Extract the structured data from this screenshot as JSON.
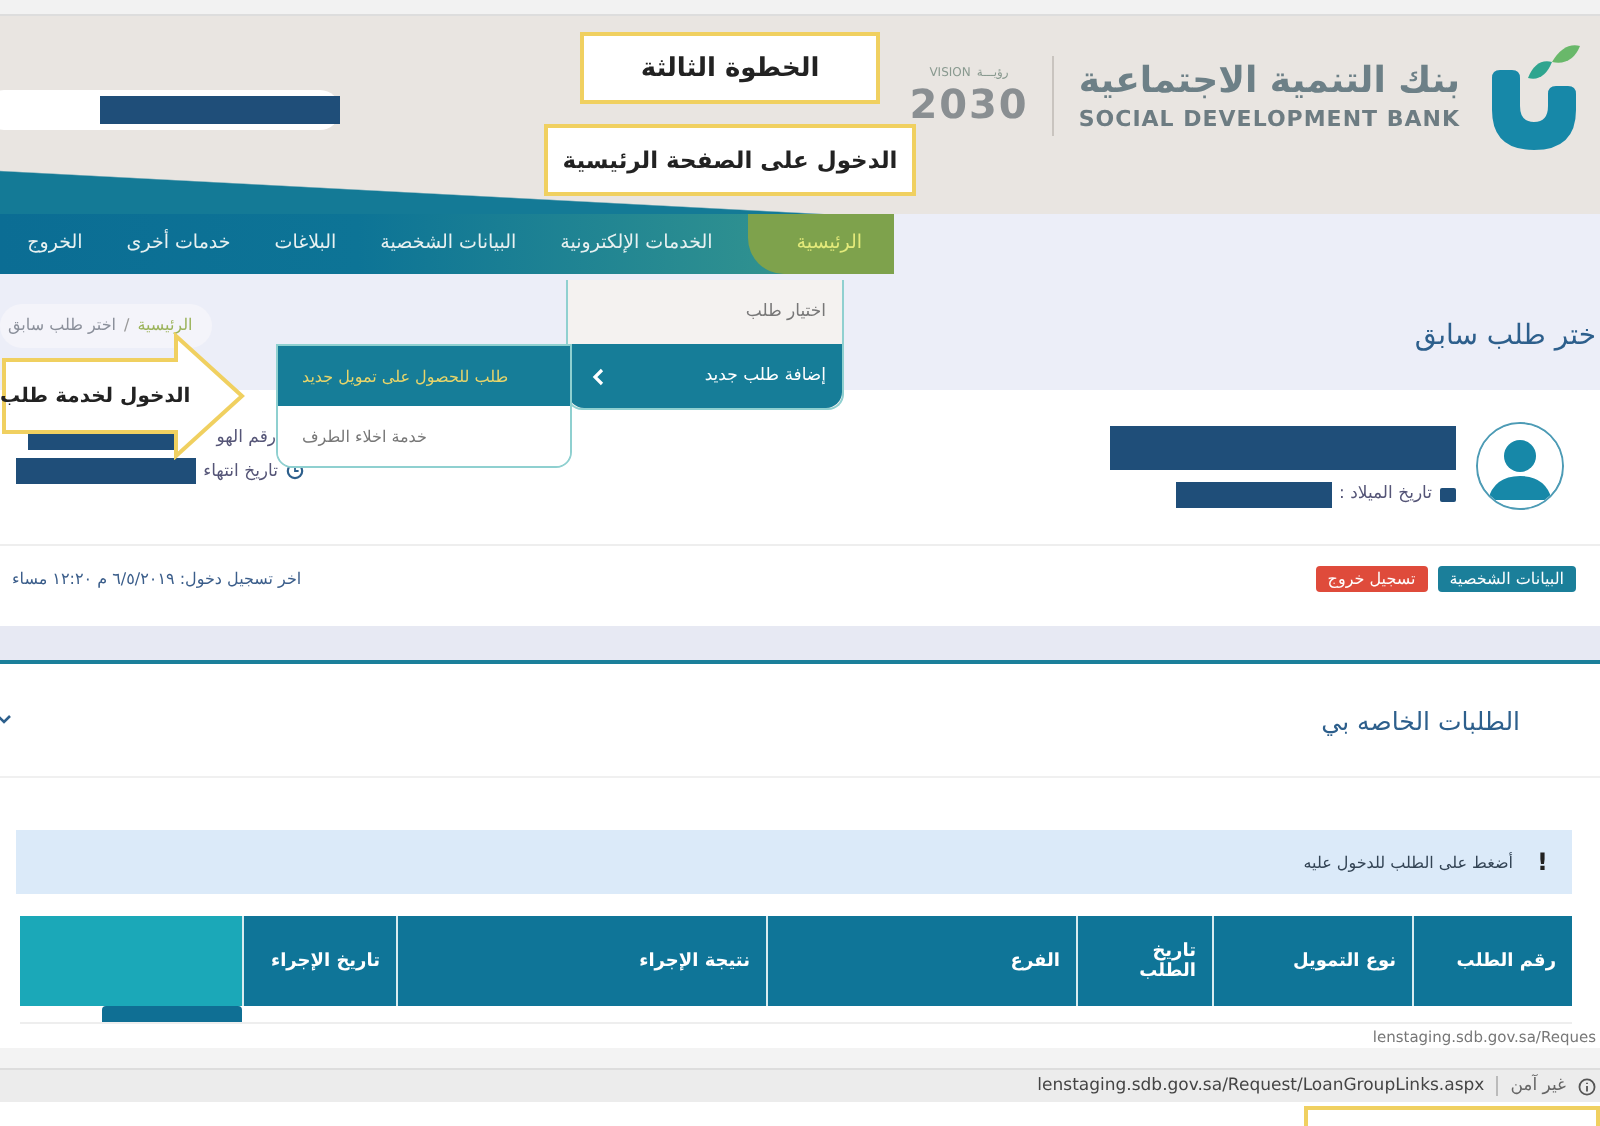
{
  "callouts": [
    {
      "kind": "box",
      "text": "الخطوة الثالثة"
    },
    {
      "kind": "box",
      "text": "الدخول على الصفحة الرئيسية"
    },
    {
      "kind": "arrow",
      "text": "الدخول لخدمة طلب"
    }
  ],
  "header": {
    "logo_arabic": "بنك التنمية الاجتماعية",
    "logo_english": "SOCIAL DEVELOPMENT BANK",
    "vision_label": "VISION",
    "vision_arabic": "رؤيـــة",
    "vision_year": "2030"
  },
  "nav": [
    {
      "label": "الرئيسية",
      "selected": true
    },
    {
      "label": "الخدمات الإلكترونية",
      "selected": false
    },
    {
      "label": "البيانات الشخصية",
      "selected": false
    },
    {
      "label": "البلاغات",
      "selected": false
    },
    {
      "label": "خدمات أخرى",
      "selected": false
    },
    {
      "label": "الخروج",
      "selected": false
    }
  ],
  "menu": [
    {
      "label": "اختيار طلب",
      "selected": false
    },
    {
      "label": "إضافة طلب جديد",
      "selected": true,
      "expanded": true,
      "children": [
        {
          "label": "طلب للحصول على تمويل جديد",
          "selected": true
        },
        {
          "label": "خدمة اخلاء الطرف",
          "selected": false
        }
      ]
    }
  ],
  "page_title": "ختر طلب سابق",
  "breadcrumb": {
    "home": "الرئيسية",
    "separator": "/",
    "current": "اختر طلب سابق"
  },
  "profile": {
    "birth_label": "تاريخ الميلاد :",
    "id_label": "رقم الهو",
    "expiry_label": "تاريخ انتهاء"
  },
  "buttons": [
    {
      "kind": "primary",
      "label": "البيانات الشخصية"
    },
    {
      "kind": "danger",
      "label": "تسجيل خروج"
    }
  ],
  "last_login": "اخر تسجيل دخول: ٦/٥/٢٠١٩ م ١٢:٢٠ مساء",
  "requests": {
    "title": "الطلبات الخاصه بي",
    "alert_icon": "!",
    "alert": "أضغط على الطلب للدخول عليه"
  },
  "table": {
    "columns": [
      "رقم الطلب",
      "نوع التمويل",
      "تاريخ الطلب",
      "الفرع",
      "نتيجة الإجراء",
      "تاريخ الإجراء"
    ]
  },
  "browser": {
    "url_fragment": "lenstaging.sdb.gov.sa/Reques",
    "url": "lenstaging.sdb.gov.sa/Request/LoanGroupLinks.aspx",
    "security": "غير آمن"
  }
}
